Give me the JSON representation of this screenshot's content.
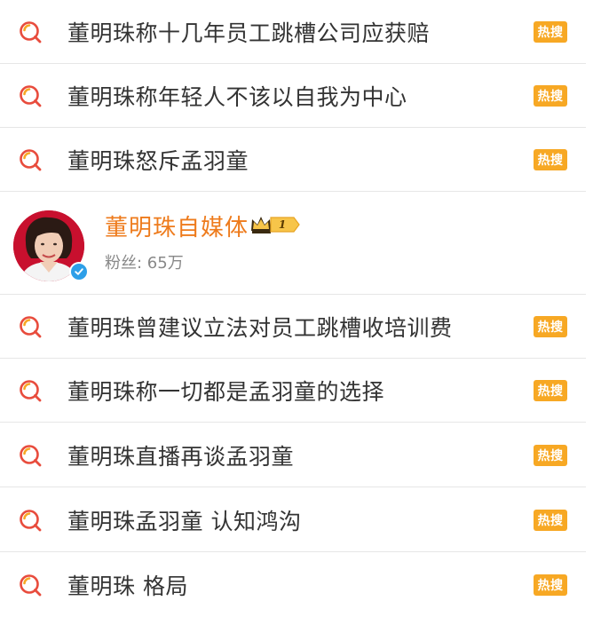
{
  "hot_searches_top": [
    {
      "text": "董明珠称十几年员工跳槽公司应获赔",
      "badge": "热搜"
    },
    {
      "text": "董明珠称年轻人不该以自我为中心",
      "badge": "热搜"
    },
    {
      "text": "董明珠怒斥孟羽童",
      "badge": "热搜"
    }
  ],
  "user_card": {
    "name": "董明珠自媒体",
    "level_badge": "1",
    "fans_label": "粉丝: 65万",
    "avatar": "person-avatar",
    "verified_icon": "verified-check-icon"
  },
  "hot_searches_bottom": [
    {
      "text": "董明珠曾建议立法对员工跳槽收培训费",
      "badge": "热搜"
    },
    {
      "text": "董明珠称一切都是孟羽童的选择",
      "badge": "热搜"
    },
    {
      "text": "董明珠直播再谈孟羽童",
      "badge": "热搜"
    },
    {
      "text": "董明珠孟羽童 认知鸿沟",
      "badge": "热搜"
    },
    {
      "text": "董明珠 格局",
      "badge": "热搜"
    }
  ],
  "colors": {
    "badge_bg": "#f7a824",
    "username": "#ee7b1c",
    "divider": "#e6e6e6",
    "search_icon_ring": "#e84c3d",
    "search_icon_accent": "#f7a824"
  }
}
